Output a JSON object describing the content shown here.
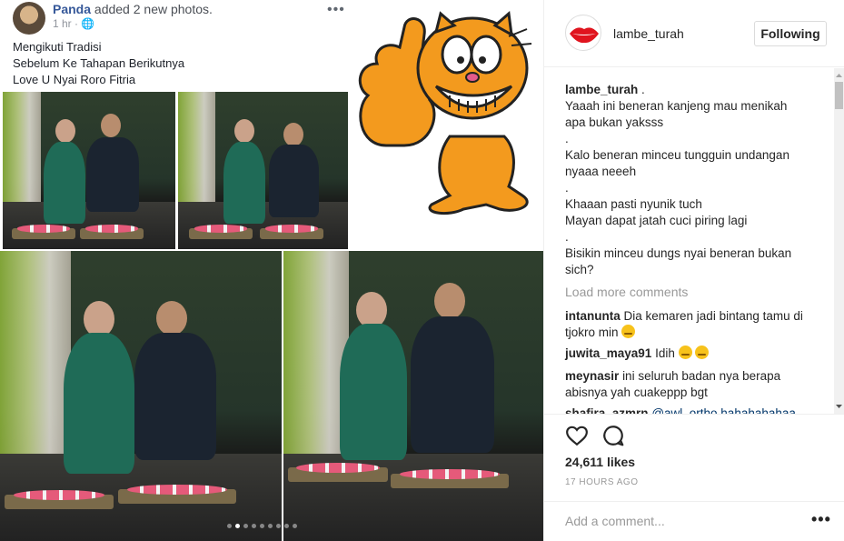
{
  "fb_post": {
    "author": "Panda",
    "action": "added 2 new photos.",
    "time": "1 hr ·",
    "menu": "•••",
    "text_lines": [
      "Mengikuti Tradisi",
      "Sebelum Ke Tahapan Berikutnya",
      "Love U Nyai Roro Fitria"
    ]
  },
  "carousel": {
    "total": 9,
    "active_index": 1
  },
  "header": {
    "username": "lambe_turah",
    "follow_label": "Following"
  },
  "caption": {
    "username": "lambe_turah",
    "first": ".",
    "lines": [
      "Yaaah ini beneran kanjeng mau menikah",
      "apa bukan yaksss",
      ".",
      "Kalo beneran minceu tungguin undangan",
      "nyaaa neeeh",
      ".",
      "Khaaan pasti nyunik tuch",
      "Mayan dapat jatah cuci piring lagi",
      ".",
      "Bisikin minceu dungs nyai beneran bukan",
      "sich?"
    ]
  },
  "load_more": "Load more comments",
  "comments": [
    {
      "user": "intanunta",
      "text": "Dia kemaren jadi bintang tamu di",
      "text2": "tjokro min"
    },
    {
      "user": "juwita_maya91",
      "text": "Idih",
      "text2": ""
    },
    {
      "user": "meynasir",
      "text": "ini seluruh badan nya berapa",
      "text2": "abisnya yah cuakeppp bgt"
    },
    {
      "user": "shafira_azmrn",
      "text": "@awl_ortho hahahahahaa",
      "text2": ""
    }
  ],
  "likes": "24,611 likes",
  "time_ago": "17 HOURS AGO",
  "add_comment_placeholder": "Add a comment...",
  "more_menu": "•••",
  "colors": {
    "border": "#efefef",
    "muted": "#999999",
    "text": "#262626",
    "fb_link": "#365899"
  }
}
